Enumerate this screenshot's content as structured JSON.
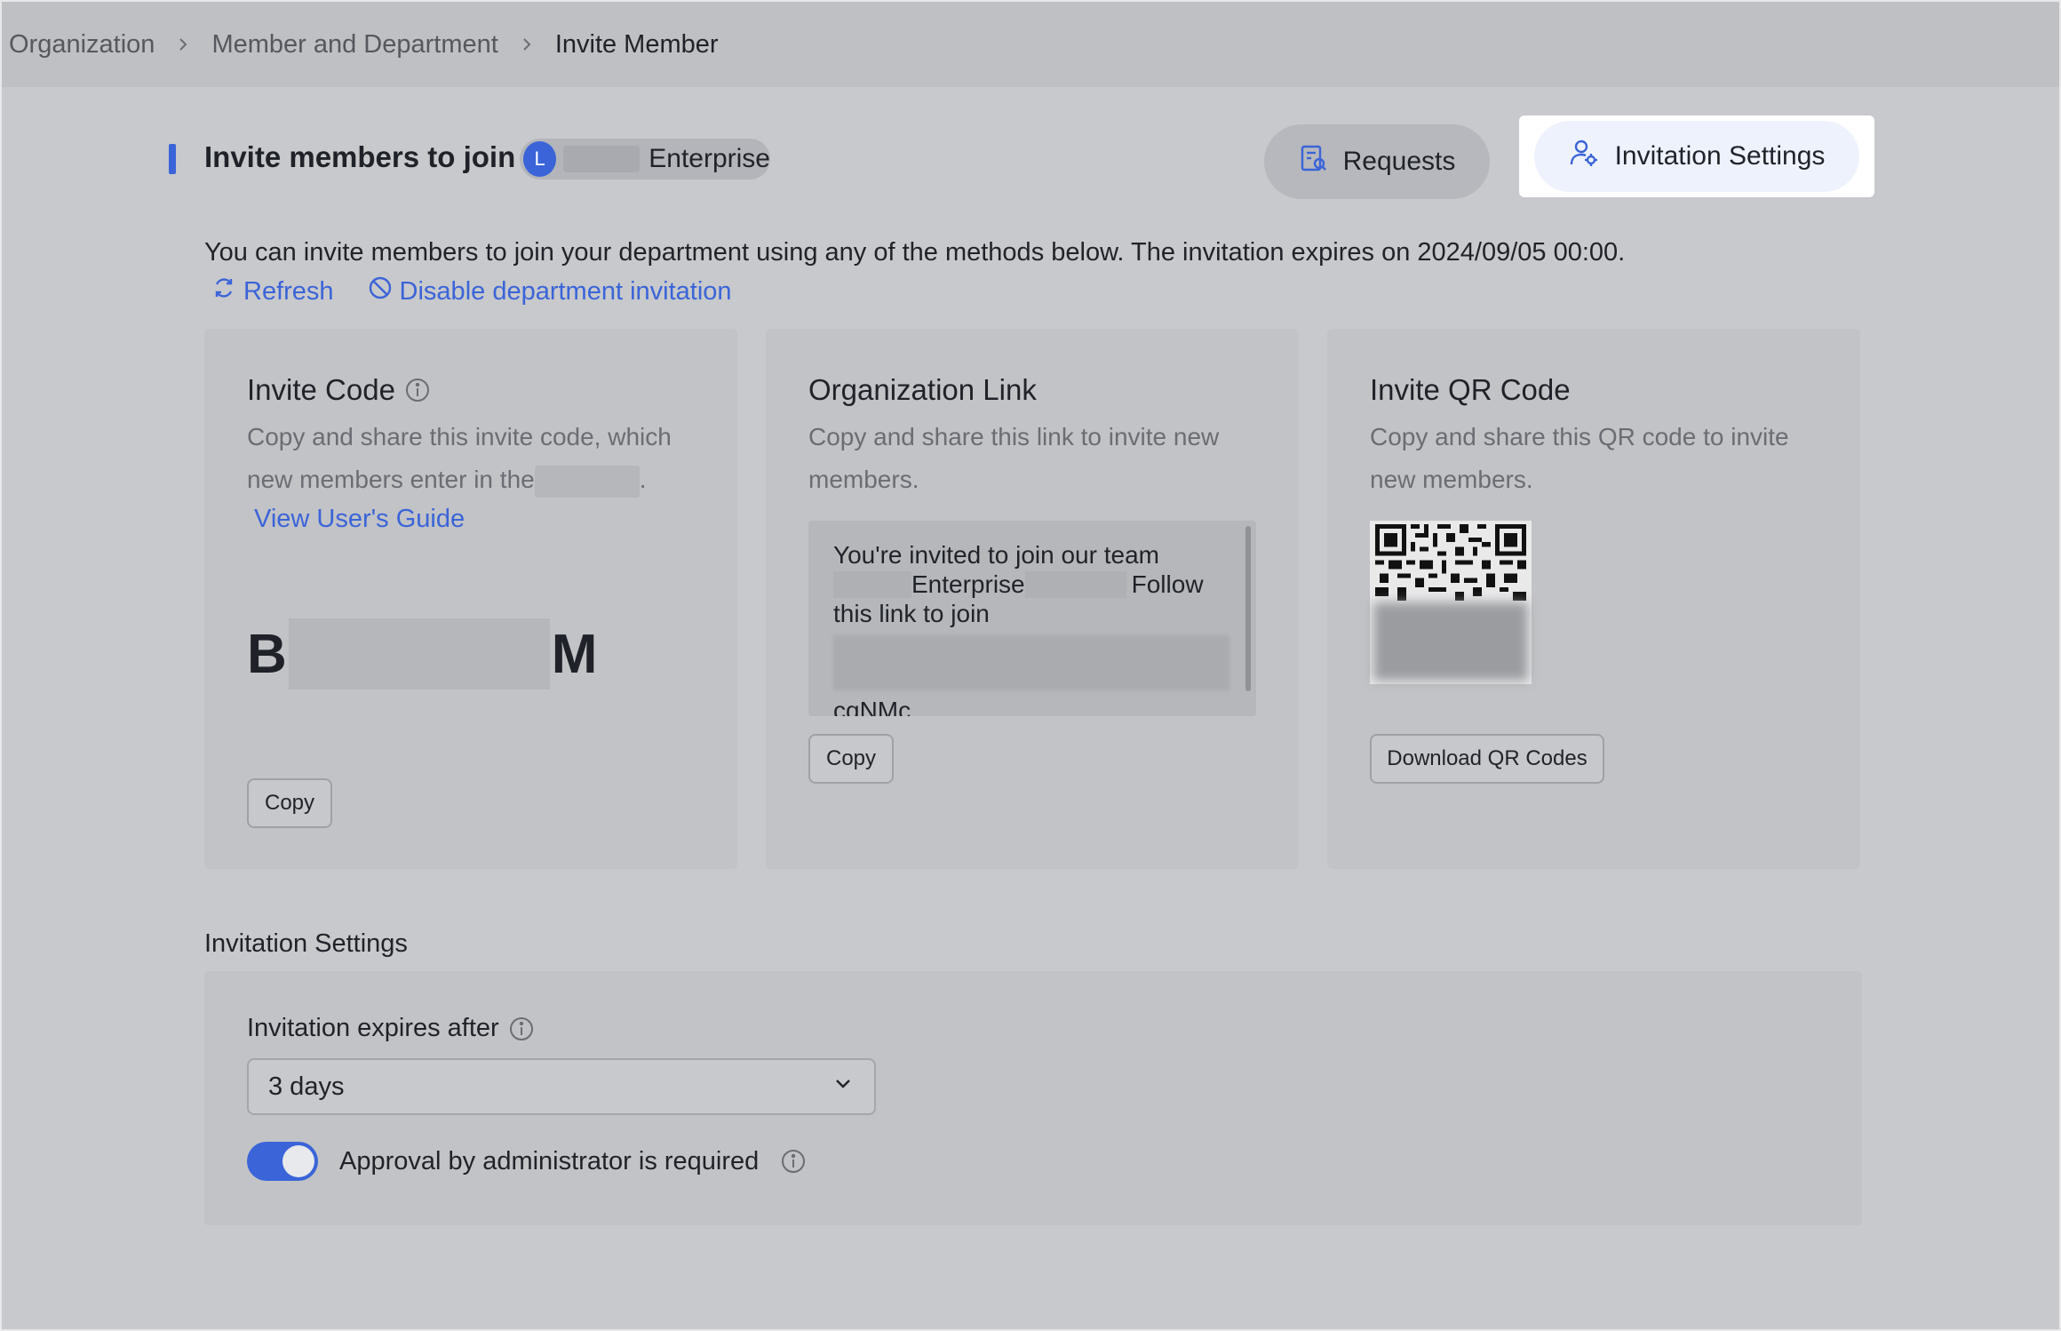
{
  "breadcrumb": {
    "items": [
      "Organization",
      "Member and Department",
      "Invite Member"
    ]
  },
  "header": {
    "title": "Invite members to join",
    "org_avatar_letter": "L",
    "org_name": "Enterprise",
    "requests_label": "Requests",
    "settings_label": "Invitation Settings"
  },
  "description": "You can invite members to join your department using any of the methods below. The invitation expires on 2024/09/05 00:00.",
  "actions": {
    "refresh": "Refresh",
    "disable": "Disable department invitation"
  },
  "cards": {
    "invite_code": {
      "title": "Invite Code",
      "desc_part1": "Copy and share this invite code, which new members enter in the",
      "desc_end": ".",
      "guide_link": "View User's Guide",
      "code_start": "B",
      "code_end": "M",
      "copy_label": "Copy"
    },
    "org_link": {
      "title": "Organization Link",
      "desc": "Copy and share this link to invite new members.",
      "text_line1": "You're invited to join our team",
      "text_enterprise": "Enterprise",
      "text_follow": "Follow",
      "text_line3": "this link to join",
      "text_tail": "cqNMc",
      "copy_label": "Copy"
    },
    "qr": {
      "title": "Invite QR Code",
      "desc": "Copy and share this QR code to invite new members.",
      "download_label": "Download QR Codes"
    }
  },
  "settings": {
    "section_label": "Invitation Settings",
    "expire_label": "Invitation expires after",
    "expire_value": "3 days",
    "approval_label": "Approval by administrator is required",
    "approval_enabled": true
  },
  "colors": {
    "accent": "#3a64d8",
    "background": "#c8c9cc"
  }
}
